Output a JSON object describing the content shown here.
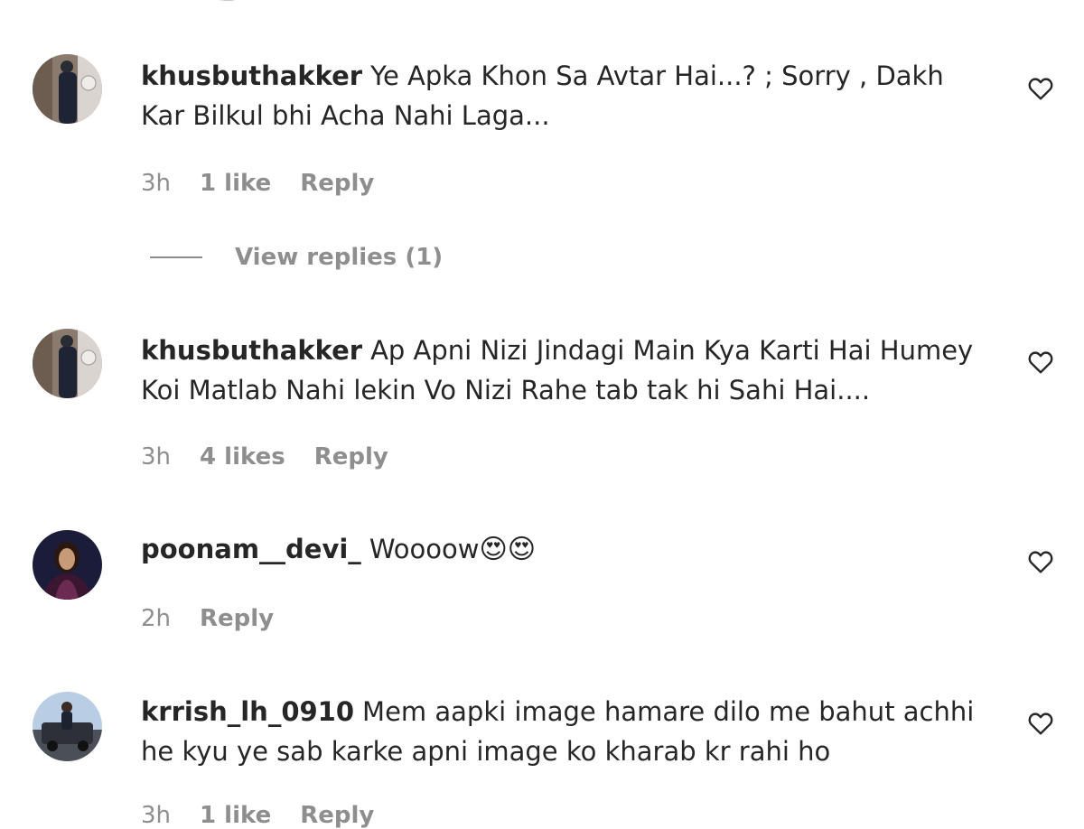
{
  "comments": [
    {
      "username": "khusbuthakker",
      "text": "Ye Apka Khon Sa Avtar Hai...? ; Sorry , Dakh Kar Bilkul bhi Acha Nahi Laga...",
      "time": "3h",
      "likes": "1 like",
      "reply_label": "Reply",
      "view_replies": "View replies (1)"
    },
    {
      "username": "khusbuthakker",
      "text": "Ap Apni Nizi Jindagi Main Kya Karti Hai Humey Koi Matlab Nahi lekin Vo Nizi Rahe tab tak hi Sahi Hai....",
      "time": "3h",
      "likes": "4 likes",
      "reply_label": "Reply"
    },
    {
      "username": "poonam__devi_",
      "text": "Woooow",
      "emoji": "😍😍",
      "time": "2h",
      "reply_label": "Reply"
    },
    {
      "username": "krrish_lh_0910",
      "text": "Mem aapki image hamare dilo me bahut achhi he kyu ye sab karke apni image ko kharab kr rahi ho",
      "time": "3h",
      "likes": "1 like",
      "reply_label": "Reply"
    }
  ],
  "icons": {
    "like": "heart-outline-icon"
  },
  "colors": {
    "text": "#262626",
    "meta": "#8e8e8e",
    "background": "#ffffff"
  }
}
